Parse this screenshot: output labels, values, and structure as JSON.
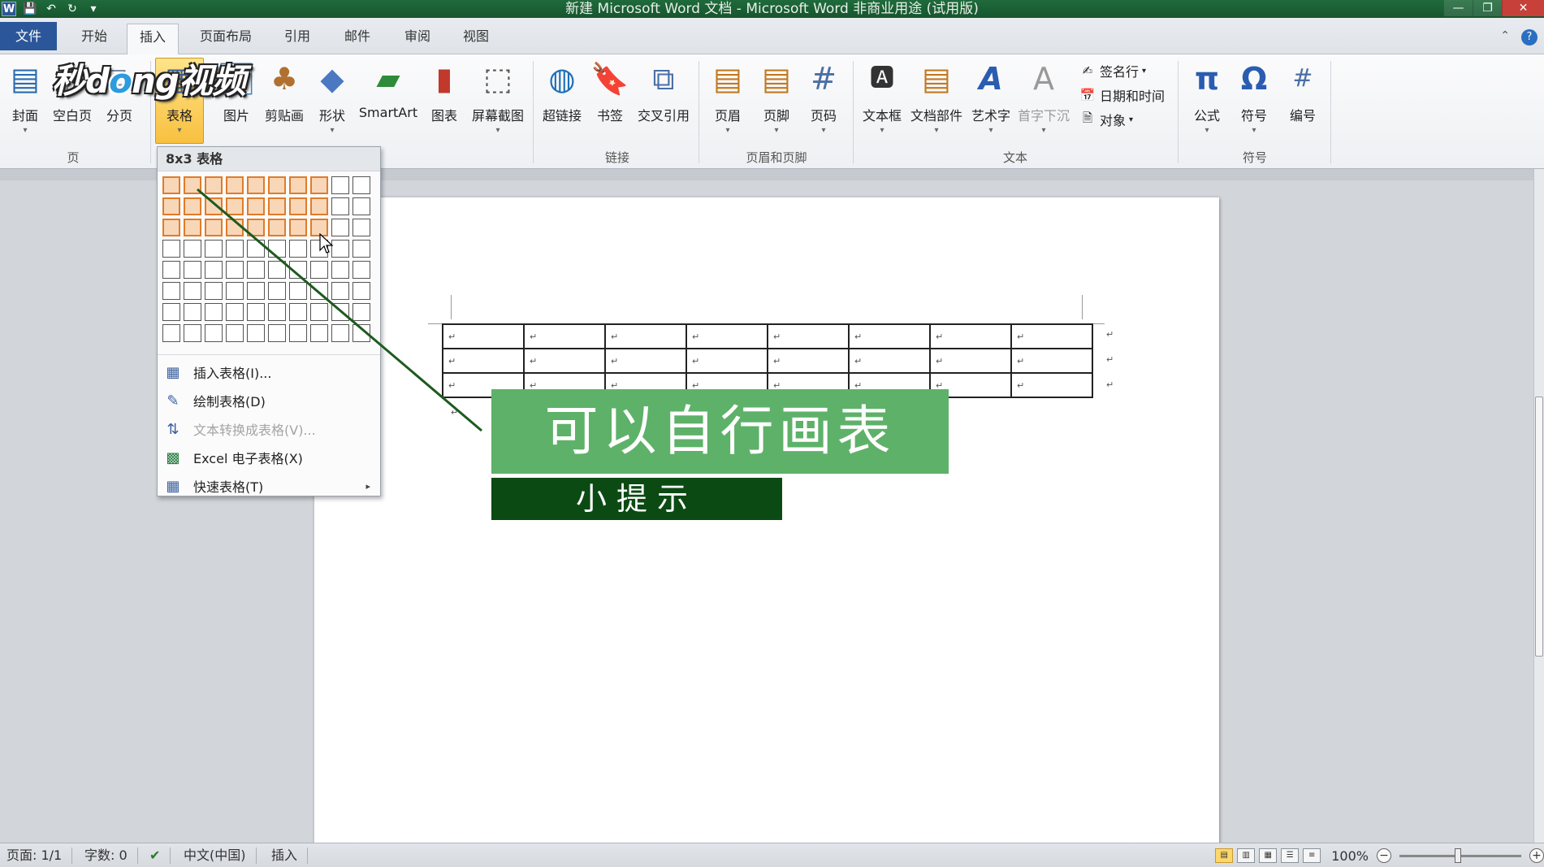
{
  "window": {
    "title": "新建 Microsoft Word 文档 - Microsoft Word 非商业用途 (试用版)",
    "quick_access": [
      {
        "name": "word-app-icon",
        "label": "W"
      },
      {
        "name": "save-icon",
        "label": "💾"
      },
      {
        "name": "undo-icon",
        "label": "↶"
      },
      {
        "name": "redo-icon",
        "label": "↻"
      },
      {
        "name": "customize-qa-icon",
        "label": "▾"
      }
    ],
    "controls": {
      "minimize": "—",
      "maximize": "❐",
      "close": "✕"
    }
  },
  "tabs": {
    "file": "文件",
    "home": "开始",
    "insert": "插入",
    "page_layout": "页面布局",
    "references": "引用",
    "mailings": "邮件",
    "review": "审阅",
    "view": "视图"
  },
  "tab_right": {
    "minimize_ribbon": "⌃",
    "help": "?"
  },
  "ribbon": {
    "pages": {
      "cover": "封面",
      "blank": "空白页",
      "break": "分页",
      "group": "页"
    },
    "table": {
      "label": "表格"
    },
    "illustrations": {
      "picture": "图片",
      "clipart": "剪贴画",
      "shapes": "形状",
      "smartart": "SmartArt",
      "chart": "图表",
      "screenshot": "屏幕截图"
    },
    "links": {
      "hyperlink": "超链接",
      "bookmark": "书签",
      "crossref": "交叉引用",
      "group": "链接"
    },
    "header_footer": {
      "header": "页眉",
      "footer": "页脚",
      "page_number": "页码",
      "group": "页眉和页脚"
    },
    "text": {
      "textbox": "文本框",
      "quickparts": "文档部件",
      "wordart": "艺术字",
      "dropcap": "首字下沉",
      "signature": "签名行",
      "datetime": "日期和时间",
      "object": "对象",
      "group": "文本"
    },
    "symbols": {
      "equation": "公式",
      "symbol": "符号",
      "number": "编号",
      "group": "符号"
    }
  },
  "watermark": {
    "text_a": "秒d",
    "text_b": "ng",
    "text_c": "视频"
  },
  "table_menu": {
    "header": "8x3 表格",
    "grid": {
      "cols": 10,
      "rows": 8,
      "selected_cols": 8,
      "selected_rows": 3
    },
    "items": [
      {
        "label": "插入表格(I)...",
        "icon": "▦",
        "disabled": false
      },
      {
        "label": "绘制表格(D)",
        "icon": "✎",
        "disabled": false
      },
      {
        "label": "文本转换成表格(V)...",
        "icon": "⇅",
        "disabled": true
      },
      {
        "label": "Excel 电子表格(X)",
        "icon": "▩",
        "disabled": false
      },
      {
        "label": "快速表格(T)",
        "icon": "▦",
        "disabled": false,
        "submenu": "▸"
      }
    ]
  },
  "document": {
    "table": {
      "rows": 3,
      "cols": 8,
      "cell_mark": "↵"
    },
    "paragraph_mark": "↵"
  },
  "annotation": {
    "tip_main": "可以自行画表",
    "tip_small": "小提示",
    "line_color": "#1e5a1e",
    "main_color": "#5eb169",
    "small_color": "#0c4a14"
  },
  "status": {
    "page": "页面: 1/1",
    "words": "字数: 0",
    "spellcheck_icon": "✔",
    "language": "中文(中国)",
    "mode": "插入",
    "zoom": "100%",
    "zoom_out": "−",
    "zoom_in": "+"
  }
}
